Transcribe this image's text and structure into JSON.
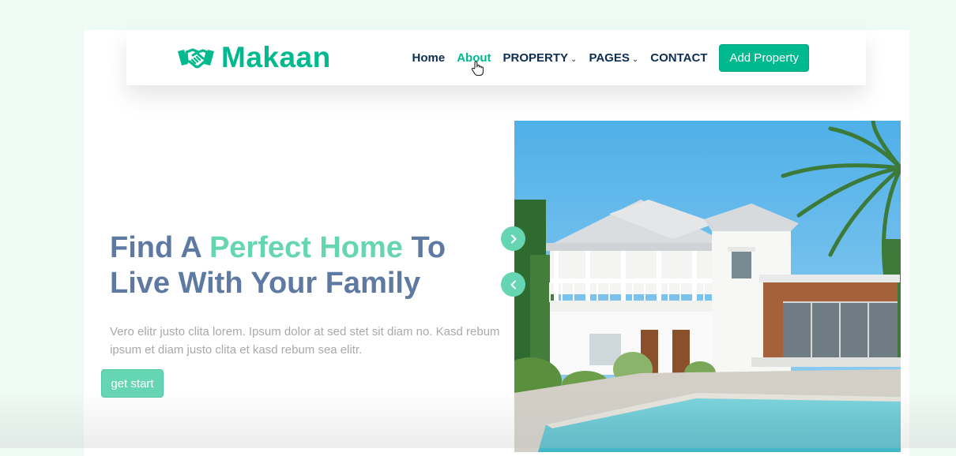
{
  "brand": {
    "name": "Makaan",
    "accent_color": "#00b98e",
    "icon": "handshake-icon"
  },
  "nav": {
    "items": [
      {
        "label": "Home"
      },
      {
        "label": "About",
        "active": true
      },
      {
        "label": "PROPERTY",
        "dropdown": true
      },
      {
        "label": "PAGES",
        "dropdown": true
      },
      {
        "label": "CONTACT"
      }
    ],
    "dropdown_caret": "⌄",
    "cta_label": "Add Property"
  },
  "hero": {
    "title_part1": "Find A ",
    "title_accent": "Perfect Home",
    "title_part2": " To Live With Your Family",
    "description": "Vero elitr justo clita lorem. Ipsum dolor at sed stet sit diam no. Kasd rebum ipsum et diam justo clita et kasd rebum sea elitr.",
    "button_label": "get start",
    "image": "house-with-pool-photo"
  },
  "carousel": {
    "next_icon": "chevron-right-icon",
    "prev_icon": "chevron-left-icon"
  },
  "colors": {
    "title": "#5e7aa2",
    "title_accent": "#66d5b2",
    "text": "#a9a9a9",
    "button": "#66d5b2"
  }
}
